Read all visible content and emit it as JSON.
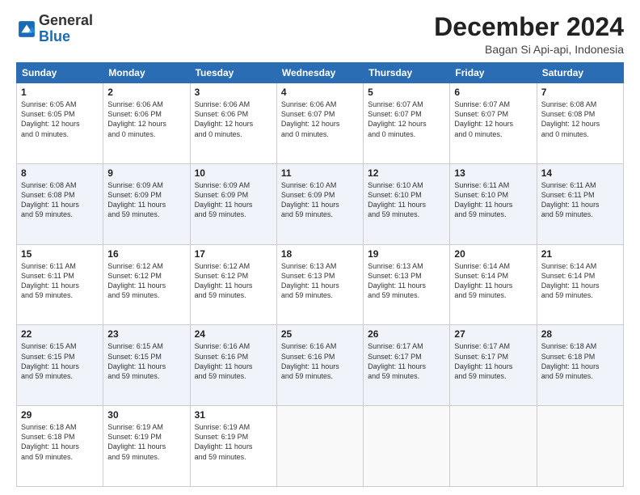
{
  "logo": {
    "general": "General",
    "blue": "Blue"
  },
  "header": {
    "month_title": "December 2024",
    "location": "Bagan Si Api-api, Indonesia"
  },
  "days_of_week": [
    "Sunday",
    "Monday",
    "Tuesday",
    "Wednesday",
    "Thursday",
    "Friday",
    "Saturday"
  ],
  "weeks": [
    [
      {
        "day": "1",
        "sunrise": "6:05 AM",
        "sunset": "6:05 PM",
        "daylight": "12 hours and 0 minutes."
      },
      {
        "day": "2",
        "sunrise": "6:06 AM",
        "sunset": "6:06 PM",
        "daylight": "12 hours and 0 minutes."
      },
      {
        "day": "3",
        "sunrise": "6:06 AM",
        "sunset": "6:06 PM",
        "daylight": "12 hours and 0 minutes."
      },
      {
        "day": "4",
        "sunrise": "6:06 AM",
        "sunset": "6:07 PM",
        "daylight": "12 hours and 0 minutes."
      },
      {
        "day": "5",
        "sunrise": "6:07 AM",
        "sunset": "6:07 PM",
        "daylight": "12 hours and 0 minutes."
      },
      {
        "day": "6",
        "sunrise": "6:07 AM",
        "sunset": "6:07 PM",
        "daylight": "12 hours and 0 minutes."
      },
      {
        "day": "7",
        "sunrise": "6:08 AM",
        "sunset": "6:08 PM",
        "daylight": "12 hours and 0 minutes."
      }
    ],
    [
      {
        "day": "8",
        "sunrise": "6:08 AM",
        "sunset": "6:08 PM",
        "daylight": "11 hours and 59 minutes."
      },
      {
        "day": "9",
        "sunrise": "6:09 AM",
        "sunset": "6:09 PM",
        "daylight": "11 hours and 59 minutes."
      },
      {
        "day": "10",
        "sunrise": "6:09 AM",
        "sunset": "6:09 PM",
        "daylight": "11 hours and 59 minutes."
      },
      {
        "day": "11",
        "sunrise": "6:10 AM",
        "sunset": "6:09 PM",
        "daylight": "11 hours and 59 minutes."
      },
      {
        "day": "12",
        "sunrise": "6:10 AM",
        "sunset": "6:10 PM",
        "daylight": "11 hours and 59 minutes."
      },
      {
        "day": "13",
        "sunrise": "6:11 AM",
        "sunset": "6:10 PM",
        "daylight": "11 hours and 59 minutes."
      },
      {
        "day": "14",
        "sunrise": "6:11 AM",
        "sunset": "6:11 PM",
        "daylight": "11 hours and 59 minutes."
      }
    ],
    [
      {
        "day": "15",
        "sunrise": "6:11 AM",
        "sunset": "6:11 PM",
        "daylight": "11 hours and 59 minutes."
      },
      {
        "day": "16",
        "sunrise": "6:12 AM",
        "sunset": "6:12 PM",
        "daylight": "11 hours and 59 minutes."
      },
      {
        "day": "17",
        "sunrise": "6:12 AM",
        "sunset": "6:12 PM",
        "daylight": "11 hours and 59 minutes."
      },
      {
        "day": "18",
        "sunrise": "6:13 AM",
        "sunset": "6:13 PM",
        "daylight": "11 hours and 59 minutes."
      },
      {
        "day": "19",
        "sunrise": "6:13 AM",
        "sunset": "6:13 PM",
        "daylight": "11 hours and 59 minutes."
      },
      {
        "day": "20",
        "sunrise": "6:14 AM",
        "sunset": "6:14 PM",
        "daylight": "11 hours and 59 minutes."
      },
      {
        "day": "21",
        "sunrise": "6:14 AM",
        "sunset": "6:14 PM",
        "daylight": "11 hours and 59 minutes."
      }
    ],
    [
      {
        "day": "22",
        "sunrise": "6:15 AM",
        "sunset": "6:15 PM",
        "daylight": "11 hours and 59 minutes."
      },
      {
        "day": "23",
        "sunrise": "6:15 AM",
        "sunset": "6:15 PM",
        "daylight": "11 hours and 59 minutes."
      },
      {
        "day": "24",
        "sunrise": "6:16 AM",
        "sunset": "6:16 PM",
        "daylight": "11 hours and 59 minutes."
      },
      {
        "day": "25",
        "sunrise": "6:16 AM",
        "sunset": "6:16 PM",
        "daylight": "11 hours and 59 minutes."
      },
      {
        "day": "26",
        "sunrise": "6:17 AM",
        "sunset": "6:17 PM",
        "daylight": "11 hours and 59 minutes."
      },
      {
        "day": "27",
        "sunrise": "6:17 AM",
        "sunset": "6:17 PM",
        "daylight": "11 hours and 59 minutes."
      },
      {
        "day": "28",
        "sunrise": "6:18 AM",
        "sunset": "6:18 PM",
        "daylight": "11 hours and 59 minutes."
      }
    ],
    [
      {
        "day": "29",
        "sunrise": "6:18 AM",
        "sunset": "6:18 PM",
        "daylight": "11 hours and 59 minutes."
      },
      {
        "day": "30",
        "sunrise": "6:19 AM",
        "sunset": "6:19 PM",
        "daylight": "11 hours and 59 minutes."
      },
      {
        "day": "31",
        "sunrise": "6:19 AM",
        "sunset": "6:19 PM",
        "daylight": "11 hours and 59 minutes."
      },
      null,
      null,
      null,
      null
    ]
  ],
  "labels": {
    "sunrise": "Sunrise: ",
    "sunset": "Sunset: ",
    "daylight": "Daylight: "
  }
}
